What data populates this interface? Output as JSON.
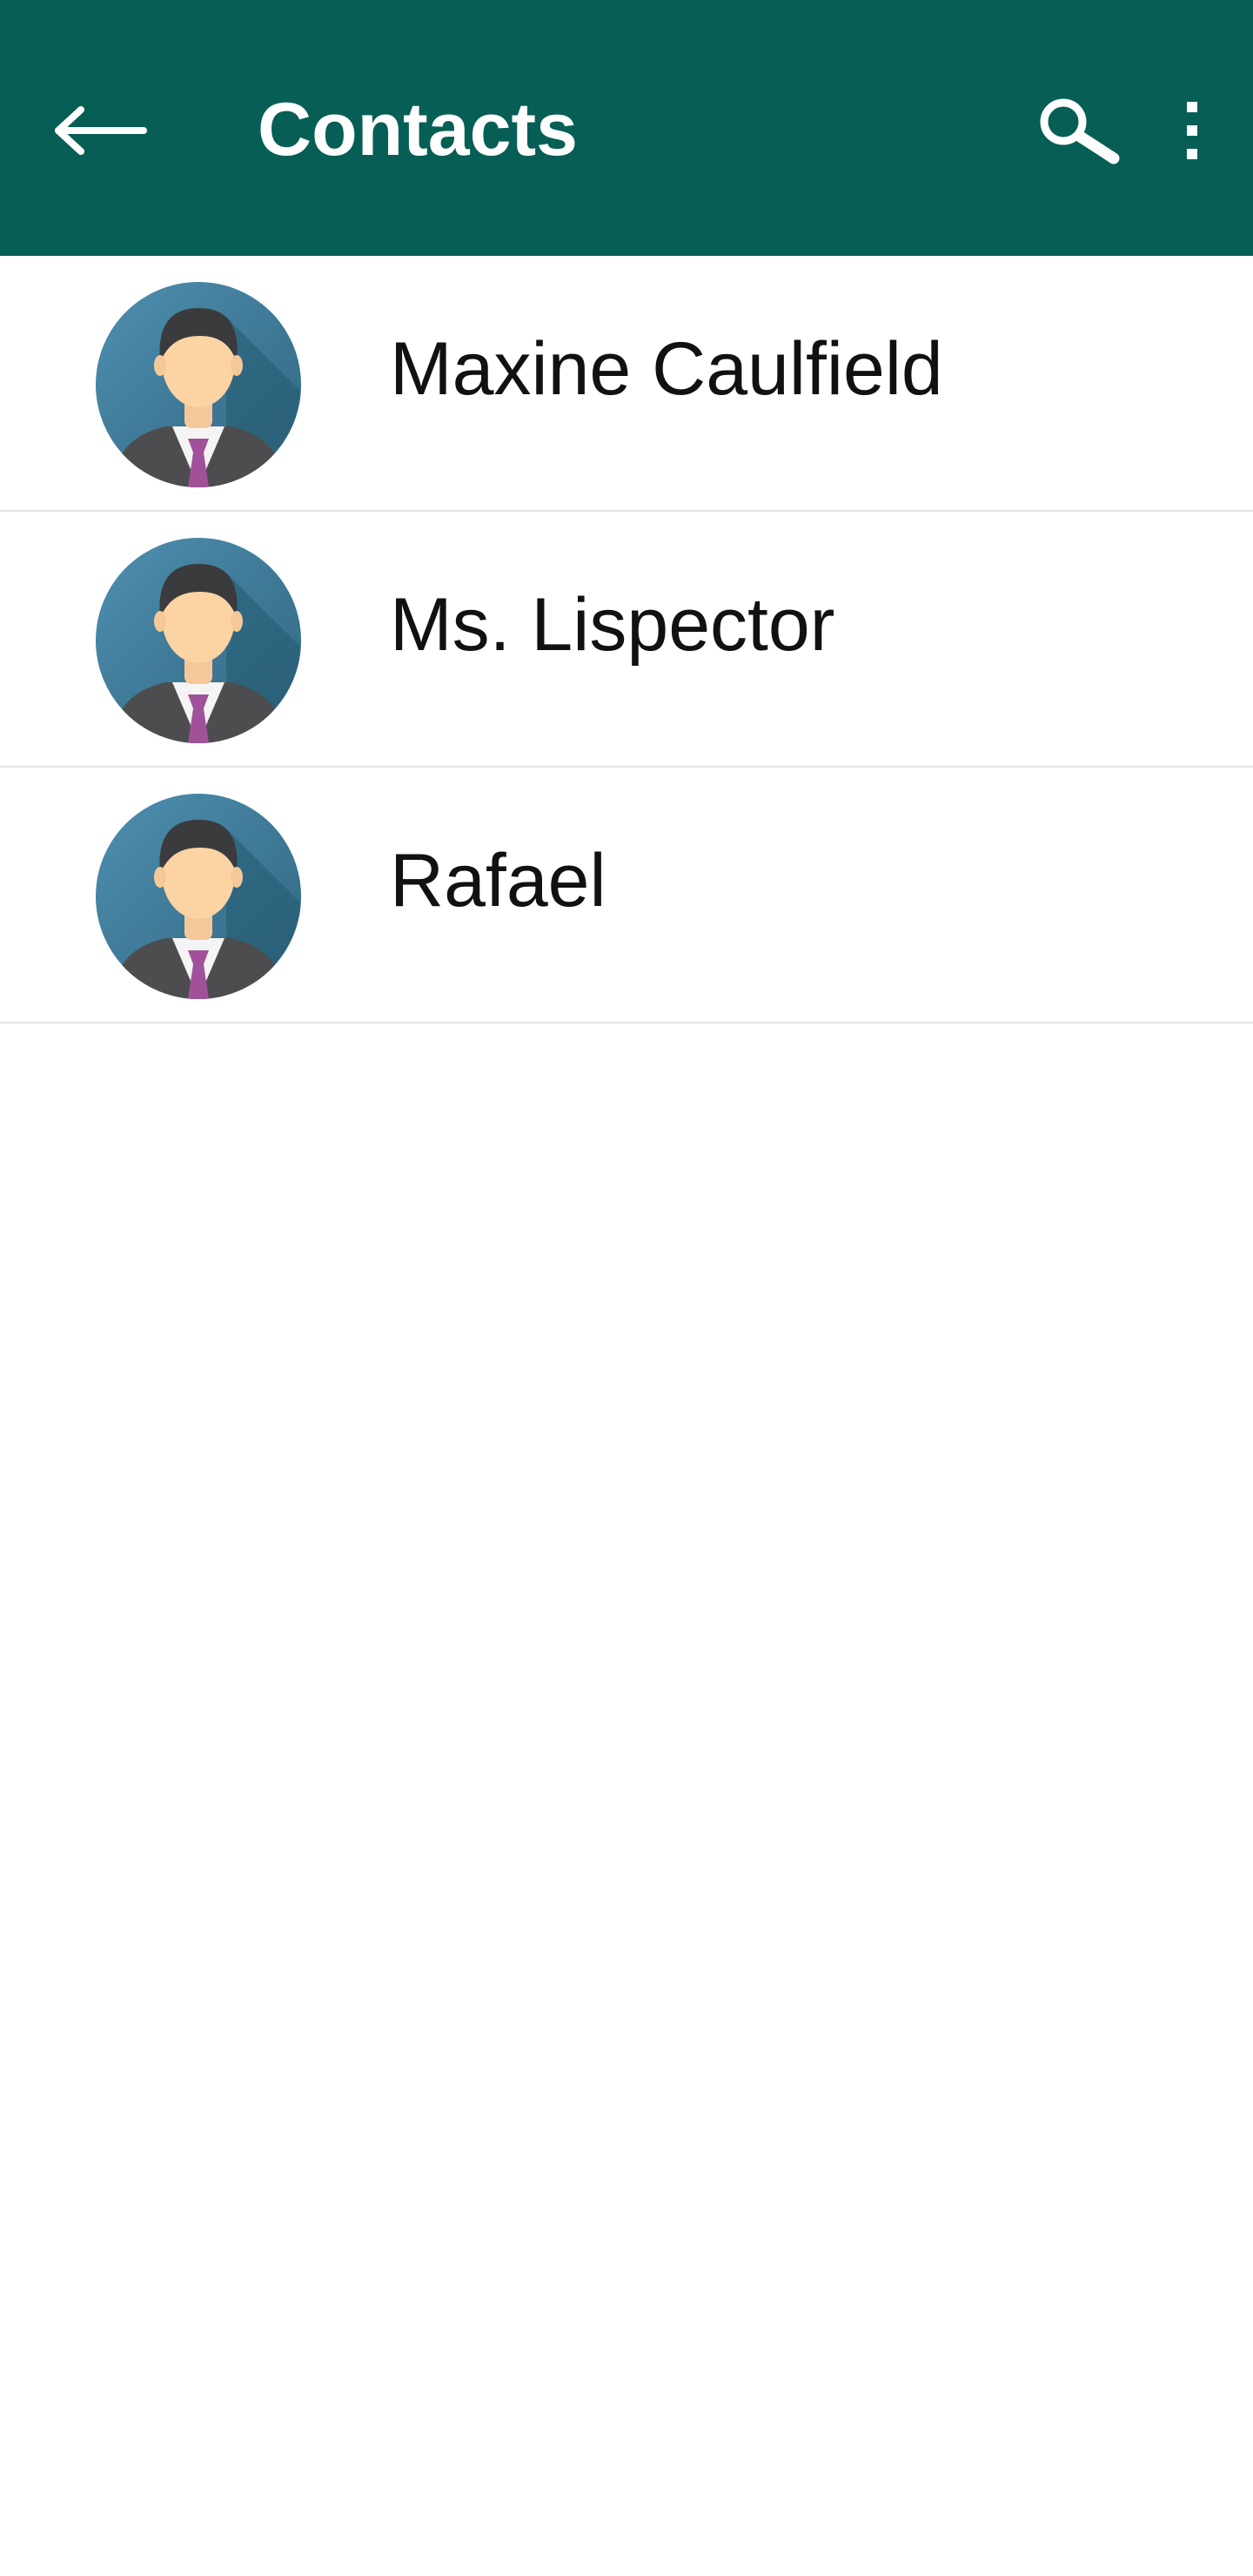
{
  "app_bar": {
    "title": "Contacts",
    "background_color": "#075e55",
    "back_icon": "arrow-left-icon",
    "search_icon": "search-icon",
    "more_icon": "more-vertical-icon"
  },
  "contacts": [
    {
      "name": "Maxine Caulfield",
      "avatar": "person-avatar-icon"
    },
    {
      "name": "Ms. Lispector",
      "avatar": "person-avatar-icon"
    },
    {
      "name": "Rafael",
      "avatar": "person-avatar-icon"
    }
  ]
}
